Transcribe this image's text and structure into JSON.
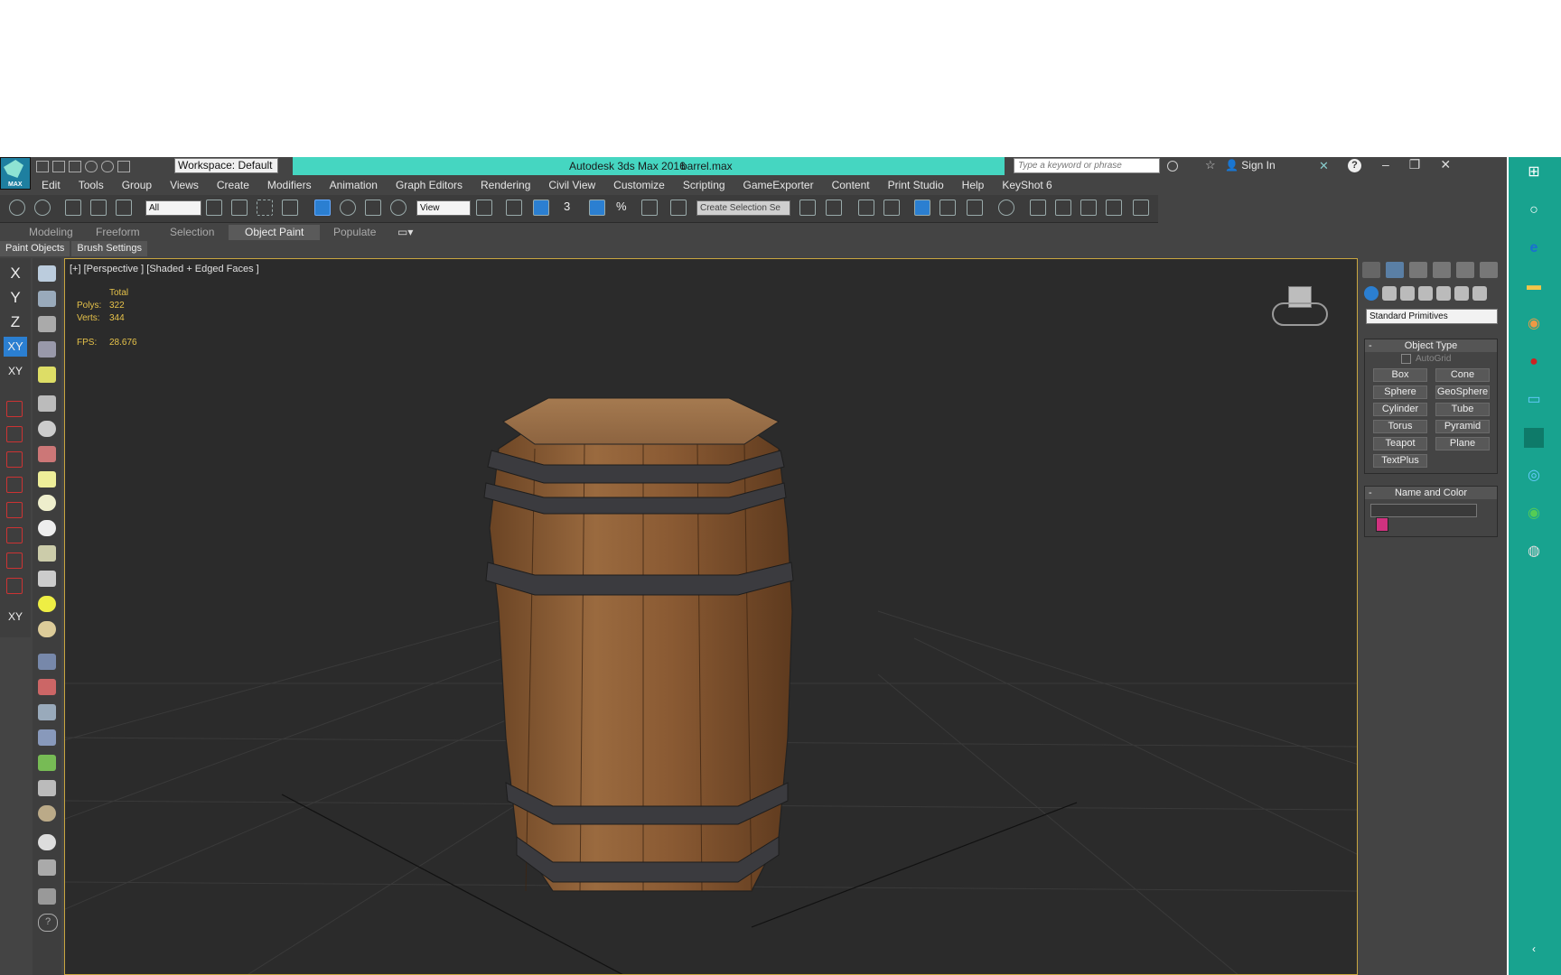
{
  "app": {
    "logo_text": "MAX",
    "workspace": "Workspace: Default",
    "title": "Autodesk 3ds Max 2016",
    "filename": "barrel.max",
    "search_placeholder": "Type a keyword or phrase",
    "sign_in": "Sign In",
    "accent_color": "#45d6c1"
  },
  "menu": [
    "Edit",
    "Tools",
    "Group",
    "Views",
    "Create",
    "Modifiers",
    "Animation",
    "Graph Editors",
    "Rendering",
    "Civil View",
    "Customize",
    "Scripting",
    "GameExporter",
    "Content",
    "Print Studio",
    "Help",
    "KeyShot 6"
  ],
  "toolbar": {
    "selection_filter": "All",
    "ref_coord": "View",
    "snap_label": "3",
    "angle_label": "%",
    "named_selection": "Create Selection Se"
  },
  "ribbon": {
    "tabs": [
      "Modeling",
      "Freeform",
      "Selection",
      "Object Paint",
      "Populate"
    ],
    "active": "Object Paint",
    "subtabs": [
      "Paint Objects",
      "Brush Settings"
    ]
  },
  "axes": [
    "X",
    "Y",
    "Z",
    "XY",
    "XY"
  ],
  "viewport": {
    "label": "[+] [Perspective ] [Shaded + Edged Faces ]",
    "stats_header": "Total",
    "polys_label": "Polys:",
    "polys": "322",
    "verts_label": "Verts:",
    "verts": "344",
    "fps_label": "FPS:",
    "fps": "28.676"
  },
  "command_panel": {
    "category": "Standard Primitives",
    "object_type_title": "Object Type",
    "autogrid": "AutoGrid",
    "buttons": [
      "Box",
      "Cone",
      "Sphere",
      "GeoSphere",
      "Cylinder",
      "Tube",
      "Torus",
      "Pyramid",
      "Teapot",
      "Plane",
      "TextPlus"
    ],
    "name_color_title": "Name and Color",
    "object_color": "#d0327f"
  }
}
